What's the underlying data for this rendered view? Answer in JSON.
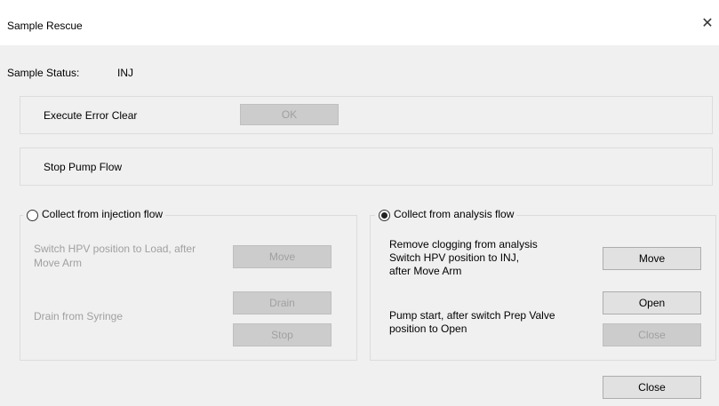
{
  "window": {
    "title": "Sample Rescue",
    "close_glyph": "✕"
  },
  "status": {
    "label": "Sample Status:",
    "value": "INJ"
  },
  "error_clear": {
    "label": "Execute Error Clear",
    "button": "OK"
  },
  "pump": {
    "label": "Stop Pump Flow"
  },
  "injection_flow": {
    "radio_label": "Collect from injection flow",
    "selected": false,
    "move_text": "Switch HPV position to Load, after Move Arm",
    "move_button": "Move",
    "drain_text": "Drain from Syringe",
    "drain_button": "Drain",
    "stop_button": "Stop"
  },
  "analysis_flow": {
    "radio_label": "Collect from analysis flow",
    "selected": true,
    "move_text_line1": "Remove clogging from analysis",
    "move_text_line2": "Switch HPV position to INJ,",
    "move_text_line3": "after Move Arm",
    "move_button": "Move",
    "pump_text_line1": "Pump start, after switch Prep Valve",
    "pump_text_line2": "position to Open",
    "open_button": "Open",
    "close_button": "Close"
  },
  "footer": {
    "close_button": "Close"
  }
}
